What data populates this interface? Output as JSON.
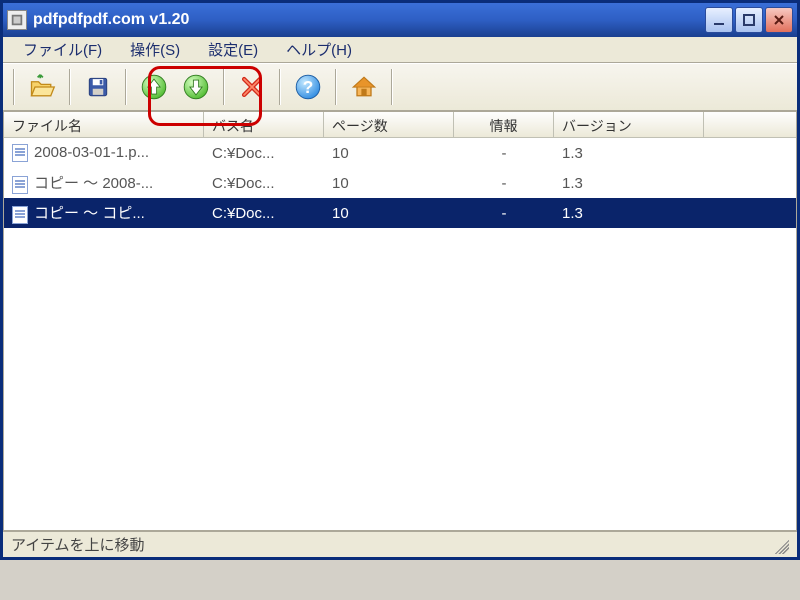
{
  "window": {
    "title": "pdfpdfpdf.com v1.20"
  },
  "menubar": {
    "file": "ファイル(F)",
    "operate": "操作(S)",
    "settings": "設定(E)",
    "help": "ヘルプ(H)"
  },
  "toolbar": {
    "open": "open",
    "save": "save",
    "move_up": "move-up",
    "move_down": "move-down",
    "delete": "delete",
    "help": "help",
    "home": "home"
  },
  "columns": {
    "filename": "ファイル名",
    "path": "バス名",
    "pages": "ページ数",
    "info": "情報",
    "version": "バージョン"
  },
  "rows": [
    {
      "filename": "2008-03-01-1.p...",
      "path": "C:¥Doc...",
      "pages": "10",
      "info": "-",
      "version": "1.3",
      "selected": false
    },
    {
      "filename": "コピー ～ 2008-...",
      "path": "C:¥Doc...",
      "pages": "10",
      "info": "-",
      "version": "1.3",
      "selected": false
    },
    {
      "filename": "コピー ～ コピ...",
      "path": "C:¥Doc...",
      "pages": "10",
      "info": "-",
      "version": "1.3",
      "selected": true
    }
  ],
  "statusbar": {
    "text": "アイテムを上に移動"
  }
}
